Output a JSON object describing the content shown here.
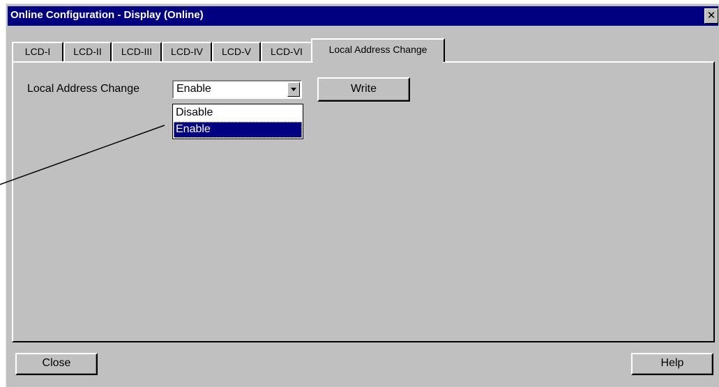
{
  "window": {
    "title": "Online Configuration - Display  (Online)",
    "close_glyph": "✕"
  },
  "tabs": [
    {
      "label": "LCD-I"
    },
    {
      "label": "LCD-II"
    },
    {
      "label": "LCD-III"
    },
    {
      "label": "LCD-IV"
    },
    {
      "label": "LCD-V"
    },
    {
      "label": "LCD-VI"
    },
    {
      "label": "Local Address Change",
      "active": true
    }
  ],
  "panel": {
    "field_label": "Local Address Change",
    "combo_value": "Enable",
    "dropdown_options": [
      "Disable",
      "Enable"
    ],
    "dropdown_selected": "Enable",
    "write_label": "Write"
  },
  "footer": {
    "close_label": "Close",
    "help_label": "Help"
  },
  "colors": {
    "title_bar": "#000080",
    "face": "#c0c0c0",
    "highlight": "#000080"
  },
  "icons": {
    "dropdown_arrow": "triangle-down-icon",
    "window_close": "close-icon"
  }
}
